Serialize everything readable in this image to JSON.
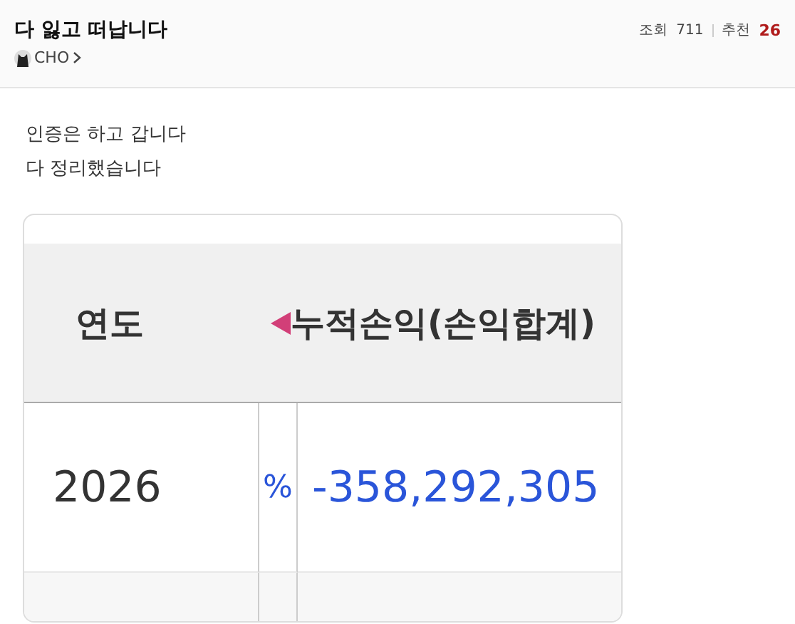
{
  "post": {
    "title": "다 잃고 떠납니다",
    "author": "CHO",
    "views_label": "조회",
    "views": "711",
    "likes_label": "추천",
    "likes": "26"
  },
  "body": [
    "인증은 하고 갑니다",
    "다 정리했습니다"
  ],
  "table": {
    "columns": [
      "연도",
      "누적손익(손익합계)"
    ],
    "rows": [
      {
        "year": "2026",
        "partial": "%",
        "total": "-358,292,305"
      }
    ]
  }
}
